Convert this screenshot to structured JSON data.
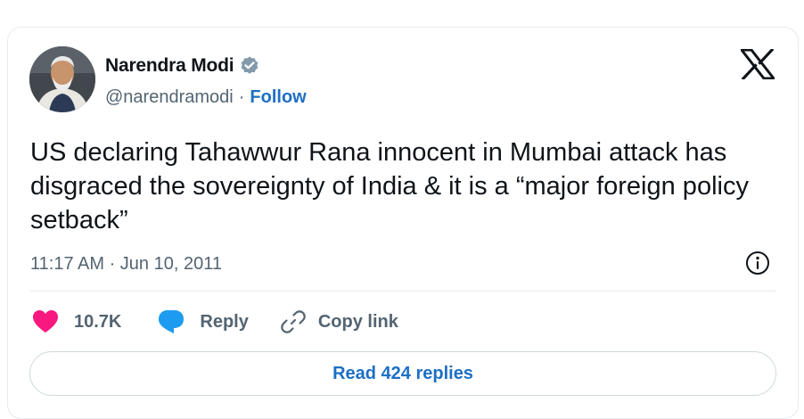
{
  "author": {
    "name": "Narendra Modi",
    "handle": "@narendramodi",
    "separator": "·",
    "follow_label": "Follow",
    "verified": true
  },
  "tweet": {
    "text": "US declaring Tahawwur Rana innocent in Mumbai attack has disgraced the sovereignty of India & it is a “major foreign policy setback”",
    "timestamp": "11:17 AM · Jun 10, 2011"
  },
  "actions": {
    "like_count": "10.7K",
    "reply_label": "Reply",
    "copy_link_label": "Copy link"
  },
  "footer": {
    "read_replies_label": "Read 424 replies"
  },
  "colors": {
    "accent": "#1d6fc4",
    "like": "#f91880",
    "reply": "#1d9bf0",
    "muted": "#536471",
    "text": "#0f1419"
  },
  "icons": {
    "brand": "x-logo-icon",
    "verified": "verified-badge-icon",
    "info": "info-icon",
    "like": "heart-icon",
    "reply": "speech-bubble-icon",
    "copy": "link-icon"
  }
}
